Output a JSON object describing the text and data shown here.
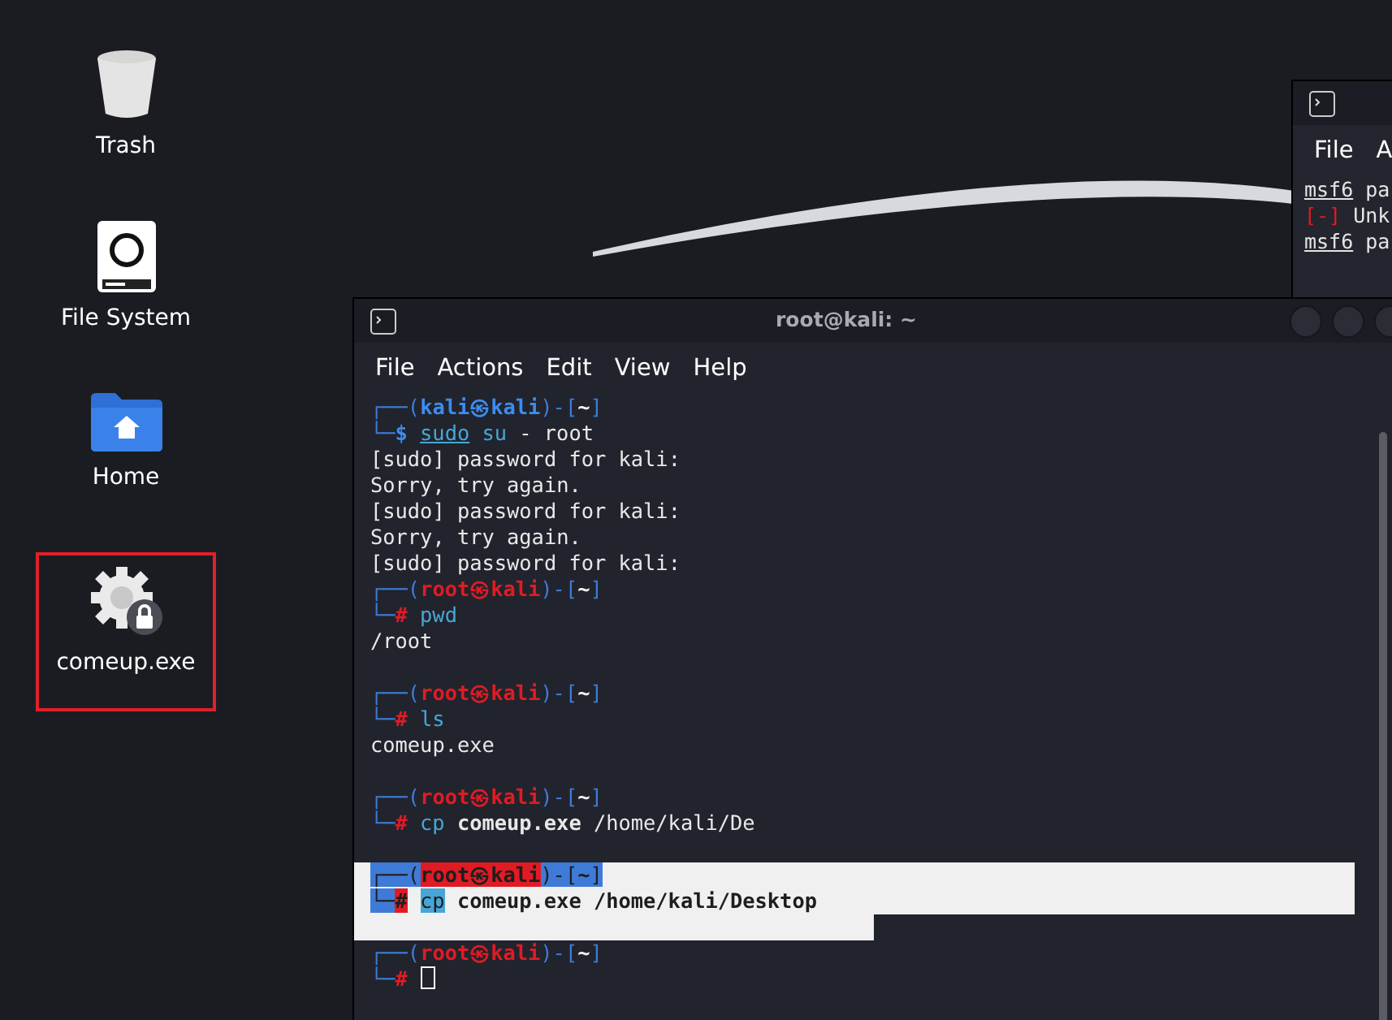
{
  "desktop_icons": [
    {
      "label": "Trash",
      "selected": false
    },
    {
      "label": "File System",
      "selected": false
    },
    {
      "label": "Home",
      "selected": false
    },
    {
      "label": "comeup.exe",
      "selected": true
    }
  ],
  "back_window": {
    "menu": [
      "File",
      "A"
    ],
    "lines": [
      {
        "segments": [
          {
            "text": "msf6",
            "kind": "prompt"
          },
          {
            "text": "pa",
            "kind": "argument"
          }
        ]
      },
      {
        "segments": [
          {
            "text": "[-]",
            "kind": "error"
          },
          {
            "text": "Unk",
            "kind": "argument"
          }
        ]
      },
      {
        "segments": [
          {
            "text": "msf6",
            "kind": "prompt"
          },
          {
            "text": "pa",
            "kind": "argument"
          }
        ]
      }
    ]
  },
  "window": {
    "title": "root@kali: ~",
    "menu": [
      "File",
      "Actions",
      "Edit",
      "View",
      "Help"
    ],
    "lines": [
      {
        "kind": "text",
        "selected": false,
        "segments": [
          {
            "text": "┌──(",
            "kind": "frame"
          },
          {
            "text": "kali㉿kali",
            "kind": "user"
          },
          {
            "text": ")-[",
            "kind": "frame"
          },
          {
            "text": "~",
            "kind": "dir"
          },
          {
            "text": "]",
            "kind": "frame"
          }
        ]
      },
      {
        "kind": "text",
        "selected": false,
        "segments": [
          {
            "text": "└─",
            "kind": "frame"
          },
          {
            "text": "$",
            "kind": "user"
          },
          {
            "text": "sudo",
            "kind": "underlined-command"
          },
          {
            "text": "su",
            "kind": "command"
          },
          {
            "text": "- root",
            "kind": "argument"
          }
        ]
      },
      {
        "kind": "text",
        "selected": false,
        "segments": [
          {
            "text": "[sudo] password for kali:",
            "kind": "output"
          }
        ]
      },
      {
        "kind": "text",
        "selected": false,
        "segments": [
          {
            "text": "Sorry, try again.",
            "kind": "output"
          }
        ]
      },
      {
        "kind": "text",
        "selected": false,
        "segments": [
          {
            "text": "[sudo] password for kali:",
            "kind": "output"
          }
        ]
      },
      {
        "kind": "text",
        "selected": false,
        "segments": [
          {
            "text": "Sorry, try again.",
            "kind": "output"
          }
        ]
      },
      {
        "kind": "text",
        "selected": false,
        "segments": [
          {
            "text": "[sudo] password for kali:",
            "kind": "output"
          }
        ]
      },
      {
        "kind": "text",
        "selected": false,
        "segments": [
          {
            "text": "┌──(",
            "kind": "frame"
          },
          {
            "text": "root㉿kali",
            "kind": "root"
          },
          {
            "text": ")-[",
            "kind": "frame"
          },
          {
            "text": "~",
            "kind": "dir"
          },
          {
            "text": "]",
            "kind": "frame"
          }
        ]
      },
      {
        "kind": "text",
        "selected": false,
        "segments": [
          {
            "text": "└─",
            "kind": "frame"
          },
          {
            "text": "#",
            "kind": "root"
          },
          {
            "text": "pwd",
            "kind": "command"
          }
        ]
      },
      {
        "kind": "text",
        "selected": false,
        "segments": [
          {
            "text": "/root",
            "kind": "output"
          }
        ]
      },
      {
        "kind": "blank",
        "selected": false
      },
      {
        "kind": "text",
        "selected": false,
        "segments": [
          {
            "text": "┌──(",
            "kind": "frame"
          },
          {
            "text": "root㉿kali",
            "kind": "root"
          },
          {
            "text": ")-[",
            "kind": "frame"
          },
          {
            "text": "~",
            "kind": "dir"
          },
          {
            "text": "]",
            "kind": "frame"
          }
        ]
      },
      {
        "kind": "text",
        "selected": false,
        "segments": [
          {
            "text": "└─",
            "kind": "frame"
          },
          {
            "text": "#",
            "kind": "root"
          },
          {
            "text": "ls",
            "kind": "command"
          }
        ]
      },
      {
        "kind": "text",
        "selected": false,
        "segments": [
          {
            "text": "comeup.exe",
            "kind": "output"
          }
        ]
      },
      {
        "kind": "blank",
        "selected": false
      },
      {
        "kind": "text",
        "selected": false,
        "segments": [
          {
            "text": "┌──(",
            "kind": "frame"
          },
          {
            "text": "root㉿kali",
            "kind": "root"
          },
          {
            "text": ")-[",
            "kind": "frame"
          },
          {
            "text": "~",
            "kind": "dir"
          },
          {
            "text": "]",
            "kind": "frame"
          }
        ]
      },
      {
        "kind": "text",
        "selected": false,
        "segments": [
          {
            "text": "└─",
            "kind": "frame"
          },
          {
            "text": "#",
            "kind": "root"
          },
          {
            "text": "cp",
            "kind": "command"
          },
          {
            "text": "comeup.exe",
            "kind": "bold-argument"
          },
          {
            "text": "/home/kali/De",
            "kind": "argument"
          }
        ]
      },
      {
        "kind": "blank",
        "selected": false
      },
      {
        "kind": "text",
        "selected": true,
        "segments": [
          {
            "text": "┌──(",
            "kind": "frame"
          },
          {
            "text": "root㉿kali",
            "kind": "root"
          },
          {
            "text": ")-[",
            "kind": "frame"
          },
          {
            "text": "~",
            "kind": "dir"
          },
          {
            "text": "]",
            "kind": "frame"
          }
        ]
      },
      {
        "kind": "text",
        "selected": true,
        "segments": [
          {
            "text": "└─",
            "kind": "frame"
          },
          {
            "text": "#",
            "kind": "root"
          },
          {
            "text": "cp",
            "kind": "command"
          },
          {
            "text": "comeup.exe /home/kali/Desktop",
            "kind": "bold-argument"
          }
        ]
      },
      {
        "kind": "blank",
        "selected": true
      },
      {
        "kind": "text",
        "selected": false,
        "segments": [
          {
            "text": "┌──(",
            "kind": "frame"
          },
          {
            "text": "root㉿kali",
            "kind": "root"
          },
          {
            "text": ")-[",
            "kind": "frame"
          },
          {
            "text": "~",
            "kind": "dir"
          },
          {
            "text": "]",
            "kind": "frame"
          }
        ]
      },
      {
        "kind": "cursor",
        "selected": false,
        "segments": [
          {
            "text": "└─",
            "kind": "frame"
          },
          {
            "text": "#",
            "kind": "root"
          }
        ]
      }
    ]
  }
}
